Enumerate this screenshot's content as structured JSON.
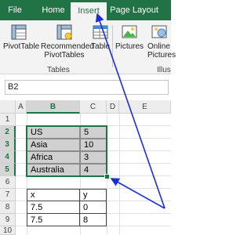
{
  "tabs": [
    "File",
    "Home",
    "Insert",
    "Page Layout"
  ],
  "ribbon": {
    "pivottable": "PivotTable",
    "recommended_line1": "Recommended",
    "recommended_line2": "PivotTables",
    "table": "Table",
    "group_tables": "Tables",
    "pictures": "Pictures",
    "online_line1": "Online",
    "online_line2": "Pictures",
    "group_illus": "Illus"
  },
  "name_box": "B2",
  "columns": [
    "A",
    "B",
    "C",
    "D",
    "E"
  ],
  "selected_column": "B",
  "rows": [
    "1",
    "2",
    "3",
    "4",
    "5",
    "6",
    "7",
    "8",
    "9",
    "10"
  ],
  "table1": [
    {
      "label": "US",
      "value": "5"
    },
    {
      "label": "Asia",
      "value": "10"
    },
    {
      "label": "Africa",
      "value": "3"
    },
    {
      "label": "Australia",
      "value": "4"
    }
  ],
  "table2_header": {
    "x": "x",
    "y": "y"
  },
  "table2_rows": [
    {
      "x": "7.5",
      "y": "0"
    },
    {
      "x": "7.5",
      "y": "8"
    }
  ],
  "colors": {
    "accent": "#217346",
    "arrow": "#1a2fd6"
  }
}
